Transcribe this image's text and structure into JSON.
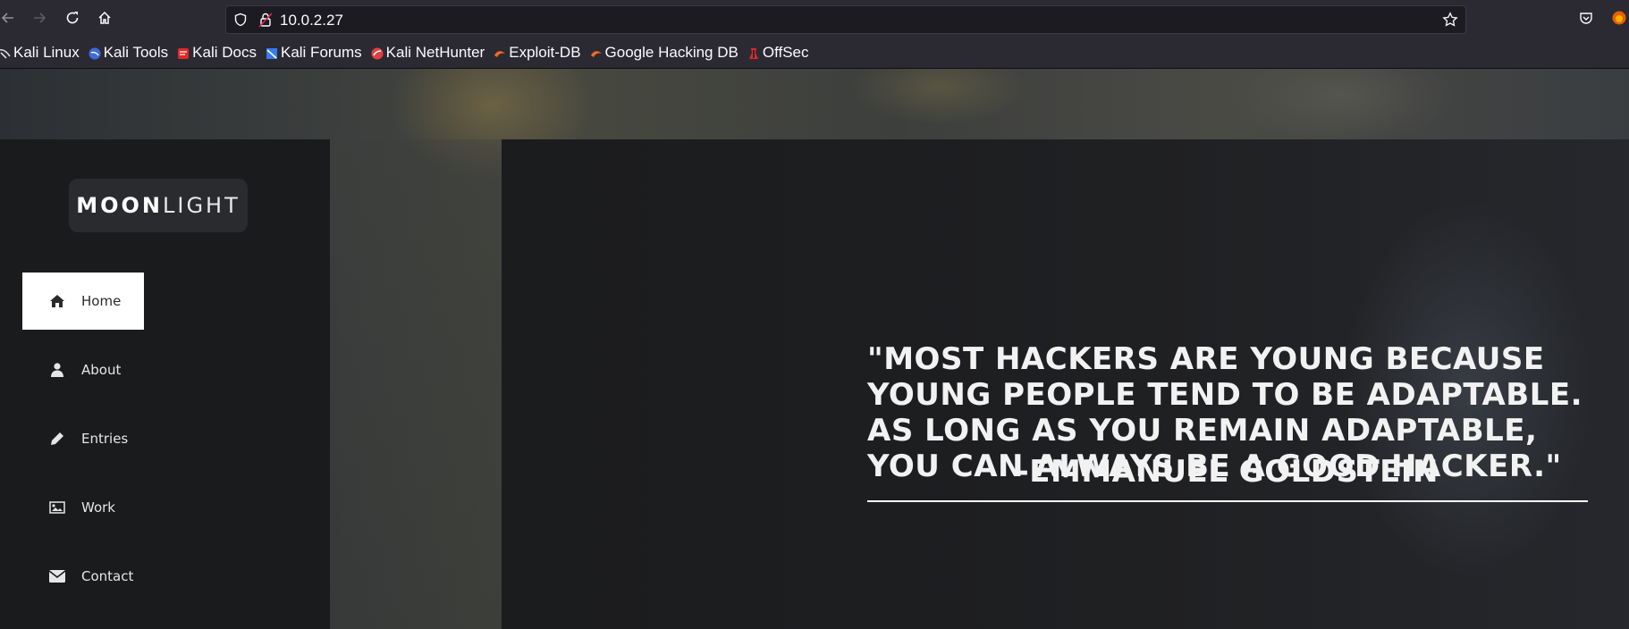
{
  "browser": {
    "url": "10.0.2.27",
    "bookmarks": [
      {
        "label": "Kali Linux",
        "icon": "kali-dragon-icon",
        "color": "#367bf0"
      },
      {
        "label": "Kali Tools",
        "icon": "kali-tools-icon",
        "color": "#3f6ad8"
      },
      {
        "label": "Kali Docs",
        "icon": "kali-docs-icon",
        "color": "#e02828"
      },
      {
        "label": "Kali Forums",
        "icon": "kali-forums-icon",
        "color": "#367bf0"
      },
      {
        "label": "Kali NetHunter",
        "icon": "nethunter-icon",
        "color": "#e04040"
      },
      {
        "label": "Exploit-DB",
        "icon": "exploit-db-icon",
        "color": "#f06a22"
      },
      {
        "label": "Google Hacking DB",
        "icon": "ghdb-icon",
        "color": "#f06a22"
      },
      {
        "label": "OffSec",
        "icon": "offsec-icon",
        "color": "#e02828"
      }
    ]
  },
  "site": {
    "logo_bold": "MOON",
    "logo_light": "LIGHT",
    "menu": [
      {
        "label": "Home",
        "icon": "home-icon",
        "active": true
      },
      {
        "label": "About",
        "icon": "user-icon",
        "active": false
      },
      {
        "label": "Entries",
        "icon": "pencil-icon",
        "active": false
      },
      {
        "label": "Work",
        "icon": "image-icon",
        "active": false
      },
      {
        "label": "Contact",
        "icon": "envelope-icon",
        "active": false
      }
    ],
    "quote": "\"MOST HACKERS ARE YOUNG BECAUSE YOUNG PEOPLE TEND TO BE ADAPTABLE. AS LONG AS YOU REMAIN ADAPTABLE, YOU CAN ALWAYS BE A GOOD HACKER.\"",
    "quote_author": "-EMMANUEL GOLDSTEIN"
  }
}
